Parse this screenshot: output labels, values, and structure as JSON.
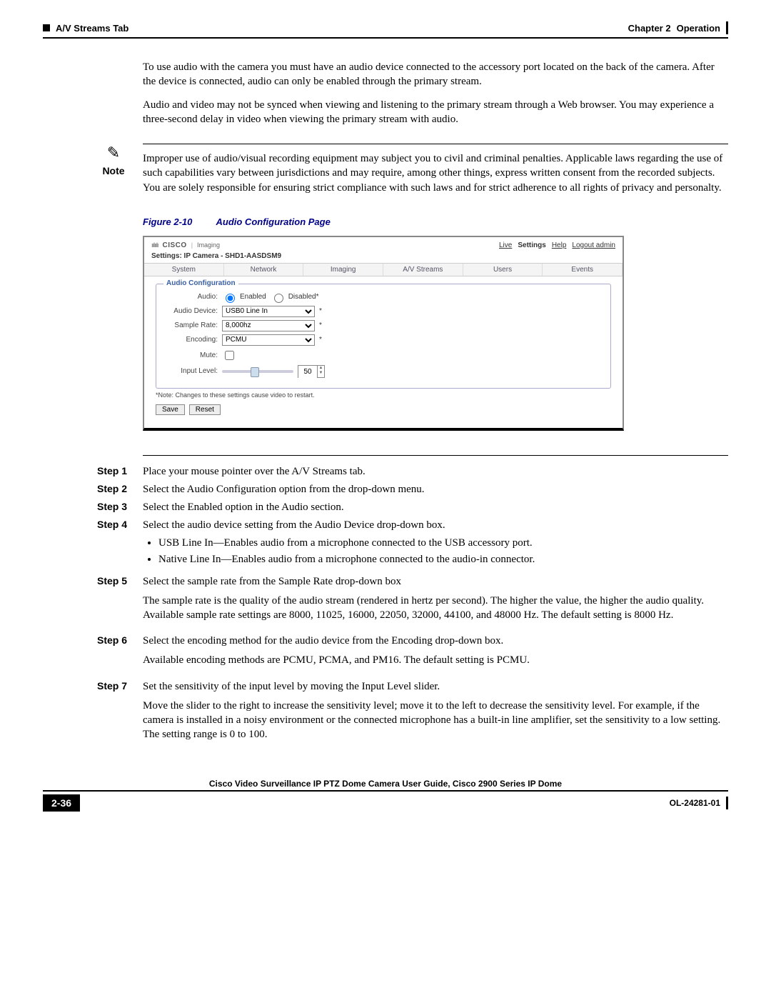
{
  "header": {
    "left": "A/V Streams Tab",
    "right_chapter": "Chapter 2",
    "right_title": "Operation"
  },
  "paras": {
    "p1": "To use audio with the camera you must have an audio device connected to the accessory port located on the back of the camera. After the device is connected, audio can only be enabled through the primary stream.",
    "p2": "Audio and video may not be synced when viewing and listening to the primary stream through a Web browser. You may experience a three-second delay in video when viewing the primary stream with audio."
  },
  "note": {
    "label": "Note",
    "text": "Improper use of audio/visual recording equipment may subject you to civil and criminal penalties. Applicable laws regarding the use of such capabilities vary between jurisdictions and may require, among other things, express written consent from the recorded subjects. You are solely responsible for ensuring strict compliance with such laws and for strict adherence to all rights of privacy and personalty."
  },
  "figure": {
    "number": "Figure 2-10",
    "title": "Audio Configuration Page"
  },
  "shot": {
    "brand": "CISCO",
    "brand_sub": "Imaging",
    "topnav": {
      "live": "Live",
      "settings": "Settings",
      "help": "Help",
      "logout": "Logout admin"
    },
    "subhead": "Settings: IP Camera - SHD1-AASDSM9",
    "tabs": [
      "System",
      "Network",
      "Imaging",
      "A/V Streams",
      "Users",
      "Events"
    ],
    "panel_title": "Audio Configuration",
    "labels": {
      "audio": "Audio:",
      "enabled": "Enabled",
      "disabled": "Disabled*",
      "device": "Audio Device:",
      "device_val": "USB0 Line In",
      "rate": "Sample Rate:",
      "rate_val": "8,000hz",
      "enc": "Encoding:",
      "enc_val": "PCMU",
      "mute": "Mute:",
      "level": "Input Level:",
      "level_val": "50"
    },
    "foot_note": "*Note: Changes to these settings cause video to restart.",
    "save": "Save",
    "reset": "Reset"
  },
  "steps": [
    {
      "label": "Step 1",
      "text": "Place your mouse pointer over the A/V Streams tab."
    },
    {
      "label": "Step 2",
      "text": "Select the Audio Configuration option from the drop-down menu."
    },
    {
      "label": "Step 3",
      "text": "Select the Enabled option in the Audio section."
    },
    {
      "label": "Step 4",
      "text": "Select the audio device setting from the Audio Device drop-down box.",
      "bullets": [
        "USB Line In—Enables audio from a microphone connected to the USB accessory port.",
        "Native Line In—Enables audio from a microphone connected to the audio-in connector."
      ]
    },
    {
      "label": "Step 5",
      "text": "Select the sample rate from the Sample Rate drop-down box",
      "extra": "The sample rate is the quality of the audio stream (rendered in hertz per second). The higher the value, the higher the audio quality. Available sample rate settings are 8000, 11025, 16000, 22050, 32000, 44100, and 48000 Hz. The default setting is 8000 Hz."
    },
    {
      "label": "Step 6",
      "text": "Select the encoding method for the audio device from the Encoding drop-down box.",
      "extra": "Available encoding methods are PCMU, PCMA, and PM16. The default setting is PCMU."
    },
    {
      "label": "Step 7",
      "text": "Set the sensitivity of the input level by moving the Input Level slider.",
      "extra": "Move the slider to the right to increase the sensitivity level; move it to the left to decrease the sensitivity level. For example, if the camera is installed in a noisy environment or the connected microphone has a built-in line amplifier, set the sensitivity to a low setting. The setting range is 0 to 100."
    }
  ],
  "footer": {
    "title": "Cisco Video Surveillance IP PTZ Dome Camera User Guide, Cisco 2900 Series IP Dome",
    "page": "2-36",
    "docid": "OL-24281-01"
  }
}
